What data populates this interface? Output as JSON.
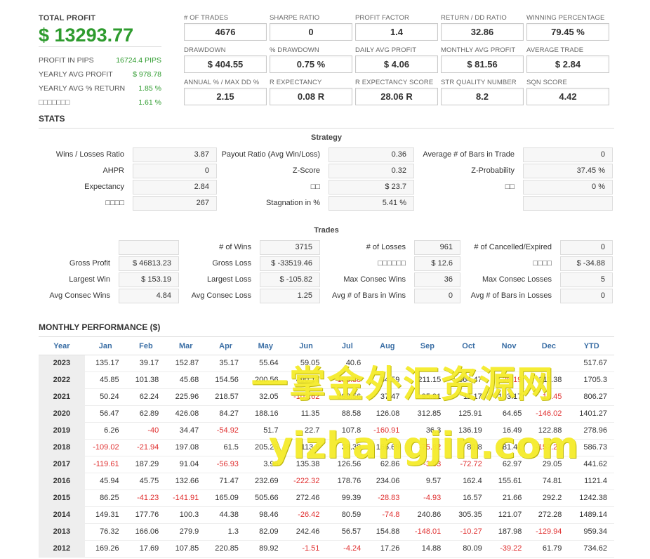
{
  "summary": {
    "total_label": "TOTAL PROFIT",
    "total_value": "$ 13293.77",
    "rows": [
      {
        "label": "PROFIT IN PIPS",
        "value": "16724.4 PIPS"
      },
      {
        "label": "YEARLY AVG PROFIT",
        "value": "$ 978.78"
      },
      {
        "label": "YEARLY AVG % RETURN",
        "value": "1.85 %"
      },
      {
        "label": "□□□□□□□",
        "value": "1.61 %"
      }
    ]
  },
  "metrics": [
    {
      "label": "# OF TRADES",
      "value": "4676"
    },
    {
      "label": "SHARPE RATIO",
      "value": "0"
    },
    {
      "label": "PROFIT FACTOR",
      "value": "1.4"
    },
    {
      "label": "RETURN / DD RATIO",
      "value": "32.86"
    },
    {
      "label": "WINNING PERCENTAGE",
      "value": "79.45 %"
    },
    {
      "label": "DRAWDOWN",
      "value": "$ 404.55"
    },
    {
      "label": "% DRAWDOWN",
      "value": "0.75 %"
    },
    {
      "label": "DAILY AVG PROFIT",
      "value": "$ 4.06"
    },
    {
      "label": "MONTHLY AVG PROFIT",
      "value": "$ 81.56"
    },
    {
      "label": "AVERAGE TRADE",
      "value": "$ 2.84"
    },
    {
      "label": "ANNUAL % / MAX DD %",
      "value": "2.15"
    },
    {
      "label": "R EXPECTANCY",
      "value": "0.08 R"
    },
    {
      "label": "R EXPECTANCY SCORE",
      "value": "28.06 R"
    },
    {
      "label": "STR QUALITY NUMBER",
      "value": "8.2"
    },
    {
      "label": "SQN SCORE",
      "value": "4.42"
    }
  ],
  "stats_title": "STATS",
  "strategy": {
    "title": "Strategy",
    "col1": [
      {
        "label": "Wins / Losses Ratio",
        "value": "3.87"
      },
      {
        "label": "AHPR",
        "value": "0"
      },
      {
        "label": "Expectancy",
        "value": "2.84"
      },
      {
        "label": "□□□□",
        "value": "267"
      }
    ],
    "col2": [
      {
        "label": "Payout Ratio (Avg Win/Loss)",
        "value": "0.36"
      },
      {
        "label": "Z-Score",
        "value": "0.32"
      },
      {
        "label": "□□",
        "value": "$ 23.7"
      },
      {
        "label": "Stagnation in %",
        "value": "5.41 %"
      }
    ],
    "col3": [
      {
        "label": "Average # of Bars in Trade",
        "value": "0"
      },
      {
        "label": "Z-Probability",
        "value": "37.45 %"
      },
      {
        "label": "□□",
        "value": "0 %"
      },
      {
        "label": "",
        "value": ""
      }
    ]
  },
  "trades": {
    "title": "Trades",
    "col1": [
      {
        "label": "",
        "value": ""
      },
      {
        "label": "Gross Profit",
        "value": "$ 46813.23"
      },
      {
        "label": "Largest Win",
        "value": "$ 153.19"
      },
      {
        "label": "Avg Consec Wins",
        "value": "4.84"
      }
    ],
    "col2": [
      {
        "label": "# of Wins",
        "value": "3715"
      },
      {
        "label": "Gross Loss",
        "value": "$ -33519.46"
      },
      {
        "label": "Largest Loss",
        "value": "$ -105.82"
      },
      {
        "label": "Avg Consec Loss",
        "value": "1.25"
      }
    ],
    "col3": [
      {
        "label": "# of Losses",
        "value": "961"
      },
      {
        "label": "□□□□□□",
        "value": "$ 12.6"
      },
      {
        "label": "Max Consec Wins",
        "value": "36"
      },
      {
        "label": "Avg # of Bars in Wins",
        "value": "0"
      }
    ],
    "col4": [
      {
        "label": "# of Cancelled/Expired",
        "value": "0"
      },
      {
        "label": "□□□□",
        "value": "$ -34.88"
      },
      {
        "label": "Max Consec Losses",
        "value": "5"
      },
      {
        "label": "Avg # of Bars in Losses",
        "value": "0"
      }
    ]
  },
  "monthly": {
    "title": "MONTHLY PERFORMANCE ($)",
    "headers": [
      "Year",
      "Jan",
      "Feb",
      "Mar",
      "Apr",
      "May",
      "Jun",
      "Jul",
      "Aug",
      "Sep",
      "Oct",
      "Nov",
      "Dec",
      "YTD"
    ],
    "rows": [
      [
        "2023",
        "135.17",
        "39.17",
        "152.87",
        "35.17",
        "55.64",
        "59.05",
        "40.6",
        "",
        "",
        "",
        "",
        "",
        "517.67"
      ],
      [
        "2022",
        "45.85",
        "101.38",
        "45.68",
        "154.56",
        "200.56",
        "490.17",
        "-158.38",
        "64.59",
        "211.15",
        "364.47",
        "-26.19",
        "211.38",
        "1705.3"
      ],
      [
        "2021",
        "50.24",
        "62.24",
        "225.96",
        "218.57",
        "32.05",
        "-101.62",
        "298.56",
        "37.47",
        "95.91",
        "11.17",
        "103.17",
        "-18.45",
        "806.27"
      ],
      [
        "2020",
        "56.47",
        "62.89",
        "426.08",
        "84.27",
        "188.16",
        "11.35",
        "88.58",
        "126.08",
        "312.85",
        "125.91",
        "64.65",
        "-146.02",
        "1401.27"
      ],
      [
        "2019",
        "6.26",
        "-40",
        "34.47",
        "-54.92",
        "51.7",
        "22.7",
        "107.8",
        "-160.91",
        "36.3",
        "136.19",
        "16.49",
        "122.88",
        "278.96"
      ],
      [
        "2018",
        "-109.02",
        "-21.94",
        "197.08",
        "61.5",
        "205.26",
        "113.8",
        "38.38",
        "166.69",
        "-75.82",
        "80.8",
        "81.41",
        "-152.21",
        "586.73"
      ],
      [
        "2017",
        "-119.61",
        "187.29",
        "91.04",
        "-56.93",
        "3.96",
        "135.38",
        "126.56",
        "62.86",
        "-3.03",
        "-72.72",
        "62.97",
        "29.05",
        "441.62"
      ],
      [
        "2016",
        "45.94",
        "45.75",
        "132.66",
        "71.47",
        "232.69",
        "-222.32",
        "178.76",
        "234.06",
        "9.57",
        "162.4",
        "155.61",
        "74.81",
        "1121.4"
      ],
      [
        "2015",
        "86.25",
        "-41.23",
        "-141.91",
        "165.09",
        "505.66",
        "272.46",
        "99.39",
        "-28.83",
        "-4.93",
        "16.57",
        "21.66",
        "292.2",
        "1242.38"
      ],
      [
        "2014",
        "149.31",
        "177.76",
        "100.3",
        "44.38",
        "98.46",
        "-26.42",
        "80.59",
        "-74.8",
        "240.86",
        "305.35",
        "121.07",
        "272.28",
        "1489.14"
      ],
      [
        "2013",
        "76.32",
        "166.06",
        "279.9",
        "1.3",
        "82.09",
        "242.46",
        "56.57",
        "154.88",
        "-148.01",
        "-10.27",
        "187.98",
        "-129.94",
        "959.34"
      ],
      [
        "2012",
        "169.26",
        "17.69",
        "107.85",
        "220.85",
        "89.92",
        "-1.51",
        "-4.24",
        "17.26",
        "14.88",
        "80.09",
        "-39.22",
        "61.79",
        "734.62"
      ]
    ]
  },
  "watermark": {
    "line1": "一掌金外汇资源网",
    "line2": "yizhangjin.com"
  }
}
